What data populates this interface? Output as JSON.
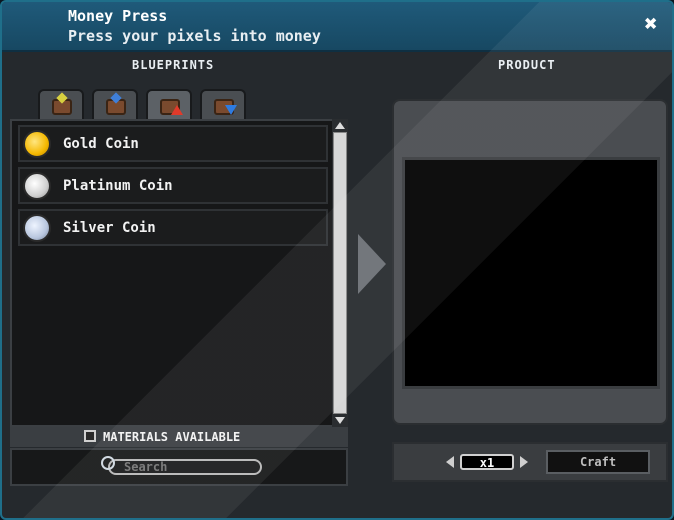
{
  "window": {
    "title": "Money Press",
    "subtitle": "Press your pixels into money",
    "close_icon": "close-icon"
  },
  "headers": {
    "blueprints": "BLUEPRINTS",
    "product": "PRODUCT"
  },
  "tabs": [
    {
      "icon": "crate-yellow-arrow-icon"
    },
    {
      "icon": "crate-blue-arrow-icon"
    },
    {
      "icon": "crate-red-up-arrow-icon",
      "active": true
    },
    {
      "icon": "crate-blue-down-arrow-icon"
    }
  ],
  "blueprints": [
    {
      "label": "Gold Coin",
      "icon": "gold-coin-icon"
    },
    {
      "label": "Platinum Coin",
      "icon": "platinum-coin-icon"
    },
    {
      "label": "Silver Coin",
      "icon": "silver-coin-icon"
    }
  ],
  "materials_filter": {
    "label": "MATERIALS AVAILABLE",
    "checked": false
  },
  "search": {
    "placeholder": "Search"
  },
  "craft": {
    "quantity": "x1",
    "button_label": "Craft"
  },
  "colors": {
    "titlebar": "#1f5a7a",
    "panel": "#25292d",
    "gold": "#f5b800",
    "up_arrow": "#e03a2a",
    "down_arrow": "#2e7be0"
  }
}
